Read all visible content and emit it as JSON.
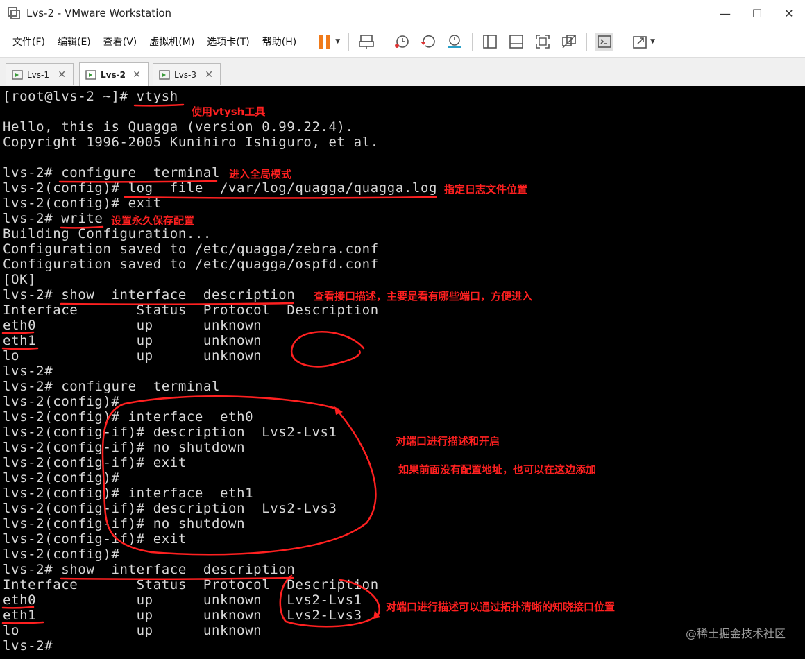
{
  "window": {
    "title": "Lvs-2 - VMware Workstation",
    "minimize": "—",
    "maximize": "☐",
    "close": "✕"
  },
  "menu": [
    "文件(F)",
    "编辑(E)",
    "查看(V)",
    "虚拟机(M)",
    "选项卡(T)",
    "帮助(H)"
  ],
  "tabs": [
    {
      "label": "Lvs-1",
      "active": false
    },
    {
      "label": "Lvs-2",
      "active": true
    },
    {
      "label": "Lvs-3",
      "active": false
    }
  ],
  "terminal": {
    "lines": [
      "[root@lvs-2 ~]# vtysh",
      "",
      "Hello, this is Quagga (version 0.99.22.4).",
      "Copyright 1996-2005 Kunihiro Ishiguro, et al.",
      "",
      "lvs-2# configure  terminal",
      "lvs-2(config)# log  file  /var/log/quagga/quagga.log",
      "lvs-2(config)# exit",
      "lvs-2# write",
      "Building Configuration...",
      "Configuration saved to /etc/quagga/zebra.conf",
      "Configuration saved to /etc/quagga/ospfd.conf",
      "[OK]",
      "lvs-2# show  interface  description",
      "Interface       Status  Protocol  Description",
      "eth0            up      unknown",
      "eth1            up      unknown",
      "lo              up      unknown",
      "lvs-2#",
      "lvs-2# configure  terminal",
      "lvs-2(config)#",
      "lvs-2(config)# interface  eth0",
      "lvs-2(config-if)# description  Lvs2-Lvs1",
      "lvs-2(config-if)# no shutdown",
      "lvs-2(config-if)# exit",
      "lvs-2(config)#",
      "lvs-2(config)# interface  eth1",
      "lvs-2(config-if)# description  Lvs2-Lvs3",
      "lvs-2(config-if)# no shutdown",
      "lvs-2(config-if)# exit",
      "lvs-2(config)#",
      "lvs-2# show  interface  description",
      "Interface       Status  Protocol  Description",
      "eth0            up      unknown   Lvs2-Lvs1",
      "eth1            up      unknown   Lvs2-Lvs3",
      "lo              up      unknown",
      "lvs-2#"
    ]
  },
  "annotations": [
    "使用vtysh工具",
    "进入全局模式",
    "指定日志文件位置",
    "设置永久保存配置",
    "查看接口描述，主要是看有哪些端口，方便进入",
    "对端口进行描述和开启",
    "如果前面没有配置地址，也可以在这边添加",
    "对端口进行描述可以通过拓扑清晰的知晓接口位置"
  ],
  "watermark": "@稀土掘金技术社区",
  "colors": {
    "terminal_bg": "#000000",
    "terminal_fg": "#d8d8d8",
    "annotation": "#ff2020",
    "pause_icon": "#f07a1a"
  }
}
